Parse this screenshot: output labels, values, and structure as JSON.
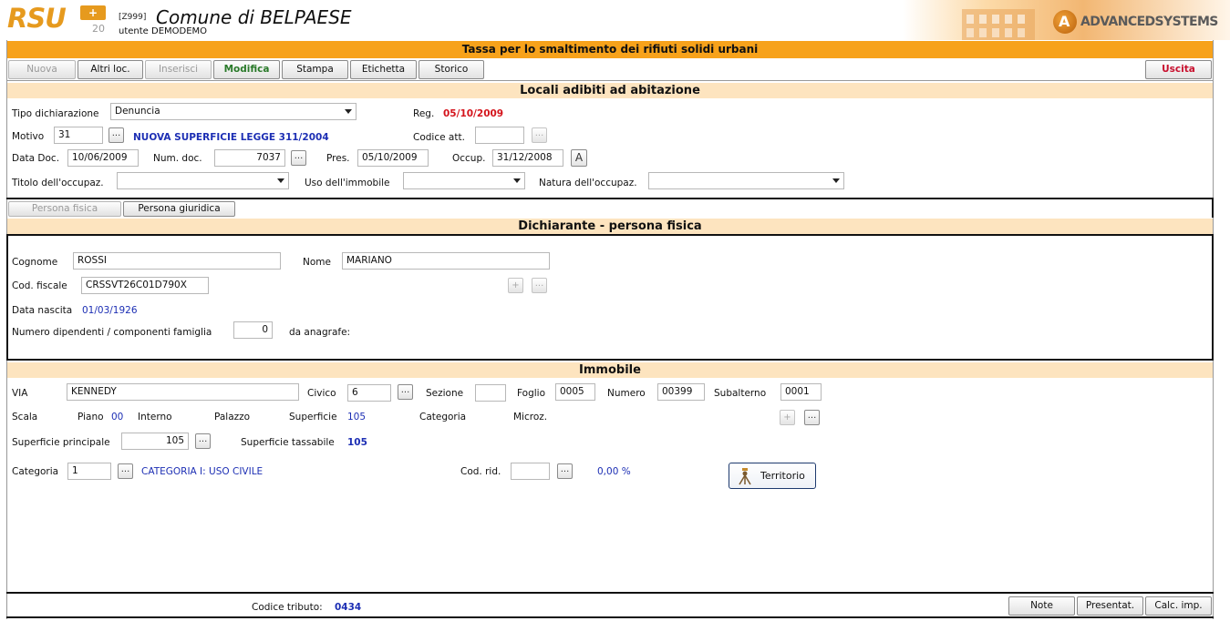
{
  "header": {
    "logo": "RSU",
    "logo_plus": "+",
    "logo_version": "20",
    "env_code": "[Z999]",
    "comune": "Comune di BELPAESE",
    "utente": "utente DEMODEMO",
    "vendor": "ADVANCEDSYSTEMS",
    "page_title": "Tassa per lo smaltimento dei rifiuti solidi urbani"
  },
  "toolbar": {
    "nuova": "Nuova",
    "altri_loc": "Altri loc.",
    "inserisci": "Inserisci",
    "modifica": "Modifica",
    "stampa": "Stampa",
    "etichetta": "Etichetta",
    "storico": "Storico",
    "uscita": "Uscita"
  },
  "locali": {
    "title": "Locali adibiti ad abitazione",
    "tipo_label": "Tipo dichiarazione",
    "tipo_value": "Denuncia",
    "reg_label": "Reg.",
    "reg_value": "05/10/2009",
    "motivo_label": "Motivo",
    "motivo_value": "31",
    "motivo_desc": "NUOVA SUPERFICIE LEGGE 311/2004",
    "codice_att_label": "Codice att.",
    "codice_att_value": "",
    "data_doc_label": "Data Doc.",
    "data_doc_value": "10/06/2009",
    "num_doc_label": "Num. doc.",
    "num_doc_value": "7037",
    "pres_label": "Pres.",
    "pres_value": "05/10/2009",
    "occup_label": "Occup.",
    "occup_value": "31/12/2008",
    "a_button": "A",
    "titolo_label": "Titolo dell'occupaz.",
    "titolo_value": "",
    "uso_label": "Uso dell'immobile",
    "uso_value": "",
    "natura_label": "Natura dell'occupaz.",
    "natura_value": ""
  },
  "persona_tabs": {
    "fisica": "Persona fisica",
    "giuridica": "Persona giuridica"
  },
  "dichiarante": {
    "title": "Dichiarante - persona fisica",
    "cognome_label": "Cognome",
    "cognome_value": "ROSSI",
    "nome_label": "Nome",
    "nome_value": "MARIANO",
    "cod_fiscale_label": "Cod. fiscale",
    "cod_fiscale_value": "CRSSVT26C01D790X",
    "data_nascita_label": "Data nascita",
    "data_nascita_value": "01/03/1926",
    "num_dip_label": "Numero dipendenti / componenti famiglia",
    "num_dip_value": "0",
    "anagrafe_label": "da anagrafe:"
  },
  "immobile": {
    "title": "Immobile",
    "via_label": "VIA",
    "via_value": "KENNEDY",
    "civico_label": "Civico",
    "civico_value": "6",
    "sezione_label": "Sezione",
    "sezione_value": "",
    "foglio_label": "Foglio",
    "foglio_value": "0005",
    "numero_label": "Numero",
    "numero_value": "00399",
    "subalterno_label": "Subalterno",
    "subalterno_value": "0001",
    "scala_label": "Scala",
    "piano_label": "Piano",
    "piano_value": "00",
    "interno_label": "Interno",
    "palazzo_label": "Palazzo",
    "superficie_label": "Superficie",
    "superficie_value": "105",
    "categoria_label2": "Categoria",
    "microz_label": "Microz.",
    "sup_princ_label": "Superficie principale",
    "sup_princ_value": "105",
    "sup_tass_label": "Superficie tassabile",
    "sup_tass_value": "105",
    "categoria_label": "Categoria",
    "categoria_value": "1",
    "categoria_desc": "CATEGORIA I: USO CIVILE",
    "cod_rid_label": "Cod. rid.",
    "cod_rid_value": "",
    "perc_value": "0,00 %",
    "territorio": "Territorio"
  },
  "footer": {
    "codice_tributo_label": "Codice tributo:",
    "codice_tributo_value": "0434",
    "note": "Note",
    "presentat": "Presentat.",
    "calc_imp": "Calc. imp."
  },
  "colors": {
    "accent_orange": "#f7a21b",
    "section_bg": "#fde4bf",
    "red_value": "#d4141c",
    "blue_value": "#1d2fb4",
    "active_green": "#2a7a2a"
  }
}
